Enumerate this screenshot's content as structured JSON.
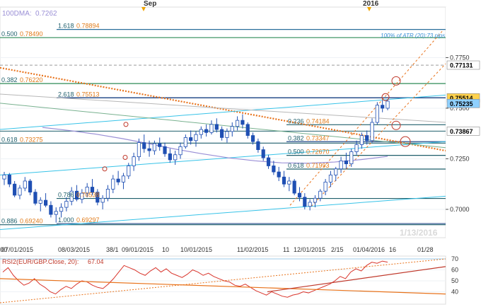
{
  "chart_data": [
    {
      "type": "candlestick",
      "title": "",
      "ylim": [
        0.686,
        0.8
      ],
      "x_ticks": [
        "07/01/2015",
        "08/03/2015",
        "09/01/2015",
        "10/01/2015",
        "11/02/2015",
        "12/01/2015",
        "01/04/2016"
      ],
      "x_tick_fragments": [
        "00",
        "38/1",
        "10",
        "11",
        "2/15",
        "16",
        "01/28"
      ],
      "top_markers": [
        "Sep",
        "2016"
      ],
      "y_ticks": [
        "0.7750",
        "0.7500",
        "0.7250",
        "0.7000"
      ],
      "price_boxes": [
        {
          "label": "0.77131",
          "value": 0.77131,
          "color": "#ffffff"
        },
        {
          "label": "0.75514",
          "value": 0.75514,
          "color": "#ffd24d"
        },
        {
          "label": "0.75235",
          "value": 0.75235,
          "color": "#8fd0ff"
        },
        {
          "label": "0.73867",
          "value": 0.73867,
          "color": "#ffffff"
        }
      ],
      "watermark": "1/13/2016",
      "legend": {
        "name": "100DMA:",
        "value": "0.7262",
        "color": "#9a8fd6"
      },
      "annotations": [
        {
          "text": "100% of ATR (20):73 pips"
        }
      ],
      "fib_levels": [
        {
          "ratio": "1.618",
          "value": "0.78894",
          "y": 0.78894
        },
        {
          "ratio": "0.500",
          "value": "0.78490",
          "y": 0.7849
        },
        {
          "ratio": "0.382",
          "value": "0.76220",
          "y": 0.7622
        },
        {
          "ratio": "2.618",
          "value": "0.75513",
          "y": 0.75513
        },
        {
          "ratio": "0.236",
          "value": "0.74184",
          "y": 0.74184
        },
        {
          "ratio": "0.618",
          "value": "0.73275",
          "y": 0.73275
        },
        {
          "ratio": "0.382",
          "value": "0.73347",
          "y": 0.73347
        },
        {
          "ratio": "0.500",
          "value": "0.72670",
          "y": 0.7267
        },
        {
          "ratio": "0.618",
          "value": "0.71993",
          "y": 0.71993
        },
        {
          "ratio": "0.786",
          "value": "0.70538",
          "y": 0.70538
        },
        {
          "ratio": "0.886",
          "value": "0.69240",
          "y": 0.6924
        },
        {
          "ratio": "1.000",
          "value": "0.69297",
          "y": 0.69297
        }
      ],
      "series": [
        {
          "name": "EUR/GBP daily",
          "ohlc": [
            [
              0.715,
              0.7185,
              0.712,
              0.717
            ],
            [
              0.717,
              0.718,
              0.711,
              0.7125
            ],
            [
              0.7125,
              0.714,
              0.706,
              0.707
            ],
            [
              0.707,
              0.712,
              0.705,
              0.7105
            ],
            [
              0.7105,
              0.716,
              0.709,
              0.714
            ],
            [
              0.714,
              0.715,
              0.707,
              0.7085
            ],
            [
              0.7085,
              0.71,
              0.702,
              0.703
            ],
            [
              0.703,
              0.706,
              0.699,
              0.7045
            ],
            [
              0.7045,
              0.708,
              0.701,
              0.702
            ],
            [
              0.702,
              0.704,
              0.696,
              0.6975
            ],
            [
              0.6975,
              0.701,
              0.6935,
              0.699
            ],
            [
              0.699,
              0.703,
              0.696,
              0.701
            ],
            [
              0.701,
              0.706,
              0.699,
              0.704
            ],
            [
              0.704,
              0.711,
              0.702,
              0.709
            ],
            [
              0.709,
              0.712,
              0.704,
              0.705
            ],
            [
              0.705,
              0.71,
              0.703,
              0.708
            ],
            [
              0.708,
              0.713,
              0.706,
              0.711
            ],
            [
              0.711,
              0.715,
              0.707,
              0.7085
            ],
            [
              0.7085,
              0.71,
              0.702,
              0.7035
            ],
            [
              0.7035,
              0.707,
              0.7,
              0.7055
            ],
            [
              0.7055,
              0.712,
              0.704,
              0.71
            ],
            [
              0.71,
              0.717,
              0.708,
              0.715
            ],
            [
              0.715,
              0.719,
              0.712,
              0.7135
            ],
            [
              0.7135,
              0.718,
              0.71,
              0.7165
            ],
            [
              0.7165,
              0.723,
              0.715,
              0.7215
            ],
            [
              0.7215,
              0.728,
              0.719,
              0.726
            ],
            [
              0.726,
              0.735,
              0.724,
              0.733
            ],
            [
              0.733,
              0.737,
              0.728,
              0.73
            ],
            [
              0.73,
              0.734,
              0.726,
              0.729
            ],
            [
              0.729,
              0.734,
              0.727,
              0.7325
            ],
            [
              0.7325,
              0.7355,
              0.729,
              0.731
            ],
            [
              0.731,
              0.733,
              0.726,
              0.7275
            ],
            [
              0.7275,
              0.73,
              0.723,
              0.7245
            ],
            [
              0.7245,
              0.729,
              0.722,
              0.727
            ],
            [
              0.727,
              0.733,
              0.725,
              0.731
            ],
            [
              0.731,
              0.737,
              0.73,
              0.7355
            ],
            [
              0.7355,
              0.739,
              0.732,
              0.734
            ],
            [
              0.734,
              0.7385,
              0.731,
              0.737
            ],
            [
              0.737,
              0.741,
              0.735,
              0.7395
            ],
            [
              0.7395,
              0.742,
              0.736,
              0.738
            ],
            [
              0.738,
              0.744,
              0.737,
              0.742
            ],
            [
              0.742,
              0.745,
              0.738,
              0.7395
            ],
            [
              0.7395,
              0.741,
              0.734,
              0.7355
            ],
            [
              0.7355,
              0.74,
              0.733,
              0.7385
            ],
            [
              0.7385,
              0.743,
              0.736,
              0.741
            ],
            [
              0.741,
              0.746,
              0.739,
              0.744
            ],
            [
              0.744,
              0.747,
              0.74,
              0.742
            ],
            [
              0.742,
              0.743,
              0.735,
              0.7365
            ],
            [
              0.7365,
              0.738,
              0.732,
              0.7335
            ],
            [
              0.7335,
              0.735,
              0.728,
              0.7295
            ],
            [
              0.7295,
              0.731,
              0.724,
              0.7255
            ],
            [
              0.7255,
              0.727,
              0.72,
              0.7215
            ],
            [
              0.7215,
              0.724,
              0.717,
              0.7185
            ],
            [
              0.7185,
              0.721,
              0.714,
              0.716
            ],
            [
              0.716,
              0.719,
              0.711,
              0.7125
            ],
            [
              0.7125,
              0.716,
              0.709,
              0.714
            ],
            [
              0.714,
              0.715,
              0.707,
              0.708
            ],
            [
              0.708,
              0.711,
              0.704,
              0.706
            ],
            [
              0.706,
              0.708,
              0.7,
              0.7015
            ],
            [
              0.7015,
              0.705,
              0.6995,
              0.7035
            ],
            [
              0.7035,
              0.707,
              0.701,
              0.7055
            ],
            [
              0.7055,
              0.71,
              0.704,
              0.709
            ],
            [
              0.709,
              0.715,
              0.707,
              0.7135
            ],
            [
              0.7135,
              0.719,
              0.711,
              0.717
            ],
            [
              0.717,
              0.721,
              0.714,
              0.72
            ],
            [
              0.72,
              0.726,
              0.718,
              0.724
            ],
            [
              0.724,
              0.728,
              0.72,
              0.7225
            ],
            [
              0.7225,
              0.73,
              0.721,
              0.7285
            ],
            [
              0.7285,
              0.734,
              0.727,
              0.732
            ],
            [
              0.732,
              0.738,
              0.73,
              0.7365
            ],
            [
              0.7365,
              0.739,
              0.732,
              0.734
            ],
            [
              0.734,
              0.745,
              0.733,
              0.743
            ],
            [
              0.743,
              0.753,
              0.742,
              0.7515
            ],
            [
              0.7515,
              0.754,
              0.748,
              0.75
            ],
            [
              0.75,
              0.7545,
              0.749,
              0.7535
            ]
          ]
        },
        {
          "name": "100DMA",
          "values": [
            0.7405,
            0.739,
            0.7372,
            0.735,
            0.7325,
            0.7298,
            0.7275,
            0.7255,
            0.724,
            0.723,
            0.7228,
            0.7234,
            0.7246,
            0.7262
          ]
        }
      ],
      "trendlines": [
        {
          "from": [
            0,
            0.77
          ],
          "to": [
            1,
            0.729
          ],
          "style": "dotted",
          "color": "#e8731c"
        },
        {
          "from": [
            0,
            0.7395
          ],
          "to": [
            1,
            0.7565
          ],
          "style": "solid",
          "color": "#37c3e8"
        },
        {
          "from": [
            0,
            0.717
          ],
          "to": [
            1,
            0.7335
          ],
          "style": "solid",
          "color": "#37c3e8"
        },
        {
          "from": [
            0,
            0.69
          ],
          "to": [
            1,
            0.7065
          ],
          "style": "solid",
          "color": "#37c3e8"
        },
        {
          "from": [
            0,
            0.757
          ],
          "to": [
            1,
            0.743
          ],
          "style": "solid",
          "color": "#b7b7b7"
        },
        {
          "from": [
            0,
            0.7525
          ],
          "to": [
            1,
            0.7305
          ],
          "style": "solid",
          "color": "#78b18f"
        }
      ]
    },
    {
      "type": "line",
      "title": "RSI2(EUR/GBP.Close, 20): 67.04",
      "legend_name": "RSI2(EUR/GBP.Close, 20):",
      "legend_value": "67.04",
      "ylim": [
        30,
        70
      ],
      "y_ticks": [
        "70",
        "60",
        "50",
        "40"
      ],
      "series": [
        {
          "name": "RSI",
          "values": [
            58,
            62,
            55,
            50,
            46,
            48,
            52,
            47,
            44,
            40,
            38,
            42,
            45,
            43,
            47,
            50,
            49,
            46,
            44,
            43,
            47,
            52,
            58,
            64,
            62,
            60,
            57,
            55,
            59,
            62,
            58,
            61,
            57,
            55,
            53,
            56,
            60,
            58,
            55,
            57,
            54,
            52,
            50,
            49,
            46,
            45,
            47,
            44,
            41,
            39,
            37,
            40,
            38,
            36,
            35,
            37,
            38,
            40,
            39,
            41,
            43,
            45,
            47,
            50,
            54,
            52,
            58,
            61,
            59,
            64,
            67,
            66,
            68,
            67
          ]
        }
      ],
      "trendlines": [
        {
          "from": [
            0,
            52
          ],
          "to": [
            1,
            38
          ],
          "style": "solid",
          "color": "#e8731c"
        },
        {
          "from": [
            0,
            30
          ],
          "to": [
            1,
            70
          ],
          "style": "dotted",
          "color": "#e8731c"
        },
        {
          "from": [
            0.6,
            40
          ],
          "to": [
            1,
            63
          ],
          "style": "solid",
          "color": "#c0392b"
        }
      ]
    }
  ]
}
